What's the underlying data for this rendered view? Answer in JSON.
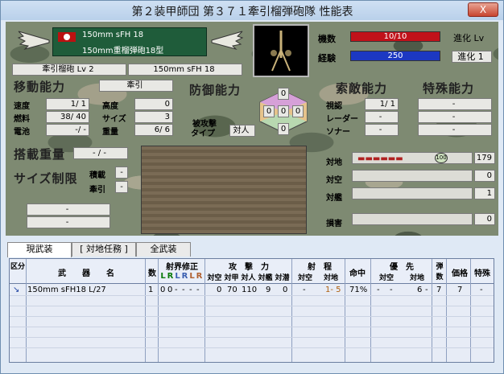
{
  "window": {
    "title": "第２装甲師団 第３７１牽引榴弾砲隊 性能表",
    "close": "X"
  },
  "unit": {
    "weapon": "150mm sFH 18",
    "name": "150mm重榴弾砲18型",
    "type_level": "牽引榴砲 Lv 2",
    "weapon2": "150mm sFH 18"
  },
  "stats": {
    "strength_label": "機数",
    "strength": "10/10",
    "exp_label": "経験",
    "exp": "250",
    "evo_label": "進化 Lv",
    "evo": "進化 1",
    "strength_pct": 100,
    "exp_pct": 100
  },
  "move": {
    "title": "移動能力",
    "mode": "牽引",
    "speed_l": "速度",
    "speed": "1/ 1",
    "alt_l": "高度",
    "alt": "0",
    "fuel_l": "燃料",
    "fuel": "38/ 40",
    "size_l": "サイズ",
    "size": "3",
    "batt_l": "電池",
    "batt": "-/ -",
    "weight_l": "重量",
    "weight": "6/ 6"
  },
  "defense": {
    "title": "防御能力",
    "top": "0",
    "left": "0",
    "center": "0",
    "right": "0",
    "bottom": "0",
    "attacked_l": "被攻撃",
    "attacked": "タイプ",
    "attacked_v": "対人"
  },
  "scout": {
    "title": "索敵能力",
    "vis_l": "視認",
    "vis": "1/ 1",
    "radar_l": "レーダー",
    "radar": "-",
    "sonar_l": "ソナー",
    "sonar": "-"
  },
  "special": {
    "title": "特殊能力",
    "s1": "-",
    "s2": "-",
    "s3": "-"
  },
  "carry": {
    "title": "搭載重量",
    "value": "- / -",
    "size_title": "サイズ制限",
    "load_l": "積載",
    "load": "-",
    "tow_l": "牽引",
    "tow": "-",
    "f1": "-",
    "f2": "-"
  },
  "targets": {
    "ground_l": "対地",
    "ground": "179",
    "ground_badge": "100",
    "air_l": "対空",
    "air": "0",
    "ship_l": "対艦",
    "ship": "1",
    "loss_l": "損害",
    "loss": "0"
  },
  "tabs": [
    "現武装",
    "[ 対地任務 ]",
    "全武装"
  ],
  "table": {
    "headers": {
      "kind": "区分",
      "weapon": "武　　器　　名",
      "count": "数",
      "range_fix": "射界修正",
      "lr": [
        "L",
        "R",
        "L",
        "R",
        "L",
        "R"
      ],
      "attack": "攻　撃　力",
      "att_sub": [
        "対空",
        "対甲",
        "対人",
        "対艦",
        "対潜"
      ],
      "range": "射　程",
      "range_sub": [
        "対空",
        "対地"
      ],
      "hit": "命中",
      "priority": "優　先",
      "pri_sub": [
        "対空",
        "対地"
      ],
      "ammo": "弾数",
      "price": "価格",
      "special": "特殊"
    },
    "row": {
      "weapon": "150mm sFH18 L/27",
      "count": "1",
      "lr1": "0",
      "lr2": "0",
      "lr3": "-",
      "lr4": "-",
      "lr5": "-",
      "lr6": "-",
      "aa": "0",
      "at": "70",
      "ap": "110",
      "as": "9",
      "asub": "0",
      "r_air": "-",
      "r_gnd": "1- 5",
      "hit": "71%",
      "p1": "-",
      "p2": "-",
      "p3": "6",
      "p4": "-",
      "ammo": "7",
      "price": "7",
      "sp": "-"
    }
  }
}
